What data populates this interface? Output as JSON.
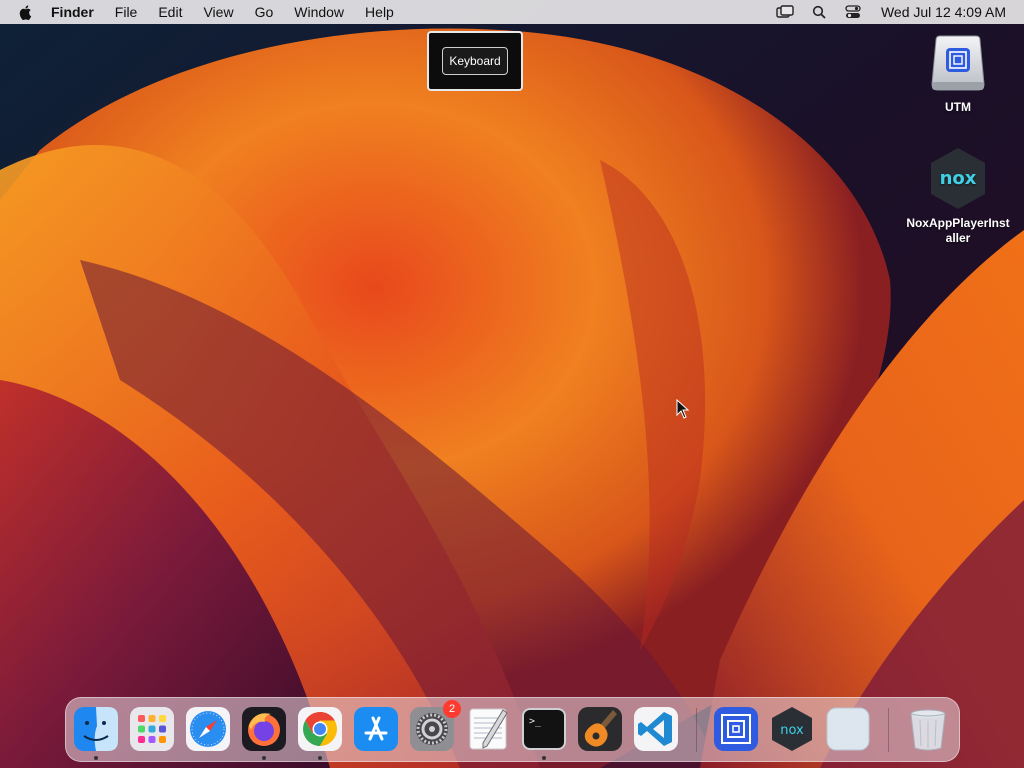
{
  "menubar": {
    "app_name": "Finder",
    "items": [
      "File",
      "Edit",
      "View",
      "Go",
      "Window",
      "Help"
    ],
    "clock": "Wed Jul 12  4:09 AM"
  },
  "popup": {
    "label": "Keyboard"
  },
  "desktop_icons": [
    {
      "label": "UTM",
      "icon": "utm-disk-icon"
    },
    {
      "label": "NoxAppPlayerInstaller",
      "label_line1": "NoxAppPlayerInst",
      "label_line2": "aller",
      "icon": "nox-icon"
    }
  ],
  "dock": {
    "items": [
      {
        "name": "Finder",
        "icon": "finder-icon",
        "running": true
      },
      {
        "name": "Launchpad",
        "icon": "launchpad-icon",
        "running": false
      },
      {
        "name": "Safari",
        "icon": "safari-icon",
        "running": false
      },
      {
        "name": "Firefox",
        "icon": "firefox-icon",
        "running": true
      },
      {
        "name": "Google Chrome",
        "icon": "chrome-icon",
        "running": true
      },
      {
        "name": "App Store",
        "icon": "app-store-icon",
        "running": false
      },
      {
        "name": "System Settings",
        "icon": "settings-icon",
        "running": false,
        "badge": "2"
      },
      {
        "name": "TextEdit",
        "icon": "textedit-icon",
        "running": false
      },
      {
        "name": "Terminal",
        "icon": "terminal-icon",
        "running": true
      },
      {
        "name": "GarageBand",
        "icon": "garageband-icon",
        "running": false
      },
      {
        "name": "Visual Studio Code",
        "icon": "vscode-icon",
        "running": false
      },
      {
        "name": "UTM",
        "icon": "utm-icon",
        "running": false
      },
      {
        "name": "Nox",
        "icon": "nox-icon",
        "running": false
      },
      {
        "name": "Preview",
        "icon": "blank-app-icon",
        "running": false
      },
      {
        "name": "Trash",
        "icon": "trash-icon",
        "running": false
      }
    ]
  },
  "colors": {
    "wallpaper_orange": "#f07a1a",
    "wallpaper_red": "#c4281c",
    "wallpaper_purple": "#5a1638",
    "wallpaper_dark": "#0d1a2b",
    "badge": "#ff3b30"
  }
}
